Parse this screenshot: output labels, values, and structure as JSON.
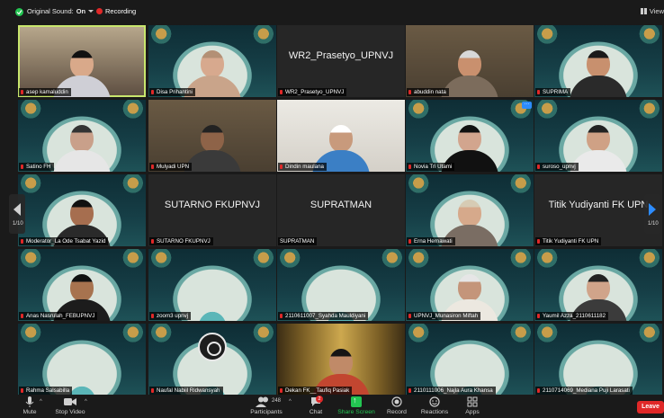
{
  "topbar": {
    "original_sound_label": "Original Sound:",
    "original_sound_value": "On",
    "recording_label": "Recording",
    "view_label": "View"
  },
  "tiles": [
    {
      "name": "asep kamaluddin",
      "bg": "room",
      "active": true,
      "skin": "#d9a98a",
      "shirt": "#cfcfd6",
      "head": "#111"
    },
    {
      "name": "Disa Prihantini",
      "bg": "decor",
      "skin": "#d7a98e",
      "shirt": "#c9a48a",
      "head": "#b39075"
    },
    {
      "name": "WR2_Prasetyo_UPNVJ",
      "bg": "dark",
      "center": "WR2_Prasetyo_UPNVJ"
    },
    {
      "name": "abuddin nata",
      "bg": "wall",
      "skin": "#c9906e",
      "shirt": "#7c6c5c",
      "head": "#d8d8d8"
    },
    {
      "name": "SUPRIMA",
      "bg": "decor",
      "skin": "#c8906e",
      "shirt": "#2a2a2a",
      "head": "#1a1a1a"
    },
    {
      "name": "Satino FH",
      "bg": "decor",
      "skin": "#c9a08a",
      "shirt": "#e6e6e6",
      "head": "#333"
    },
    {
      "name": "Mulyadi UPN",
      "bg": "wall",
      "skin": "#8e6348",
      "shirt": "#3a3a3a",
      "head": "#222"
    },
    {
      "name": "Dindin maulana",
      "bg": "white",
      "skin": "#c89a7c",
      "shirt": "#3b7fc5",
      "head": "#fff"
    },
    {
      "name": "Novia Tri Utami",
      "bg": "decor",
      "skin": "#d2a58e",
      "shirt": "#111",
      "head": "#111",
      "badge": "···"
    },
    {
      "name": "suroso_upnvj",
      "bg": "decor",
      "skin": "#cfa185",
      "shirt": "#eaeaea",
      "head": "#222"
    },
    {
      "name": "Moderator_La Ode Tsabat Yazid",
      "bg": "decor",
      "skin": "#a66e4f",
      "shirt": "#2a2a2a",
      "head": "#111"
    },
    {
      "name": "SUTARNO FKUPNVJ",
      "bg": "dark",
      "center": "SUTARNO FKUPNVJ"
    },
    {
      "name": "SUPRATMAN",
      "bg": "dark",
      "center": "SUPRATMAN",
      "nomic": true
    },
    {
      "name": "Erna Hernawati",
      "bg": "decor",
      "skin": "#d6a98b",
      "shirt": "#7a6d63",
      "head": "#d6cbb4"
    },
    {
      "name": "Titik Yudiyanti FK UPN",
      "bg": "dark",
      "center": "Titik Yudiyanti FK UPN"
    },
    {
      "name": "Anas Nasrulah_FEBUPNVJ",
      "bg": "decor",
      "skin": "#a7734f",
      "shirt": "#1c1c1c",
      "head": "#111"
    },
    {
      "name": "zoom3 upnvj",
      "bg": "decor"
    },
    {
      "name": "2110611007_Syahda Mauldiyani",
      "bg": "decor"
    },
    {
      "name": "UPNVJ_Munasiron Miftah",
      "bg": "decor",
      "skin": "#c4957a",
      "shirt": "#ece8e0",
      "head": "#e6e6e6"
    },
    {
      "name": "Yaumil Azza_2110611182",
      "bg": "decor",
      "skin": "#d0a48a",
      "shirt": "#3b3b3b",
      "head": "#222"
    },
    {
      "name": "Rahma Salsabilla",
      "bg": "decor"
    },
    {
      "name": "Naufal Nabiil Ridwansyah",
      "bg": "decor",
      "obs": true
    },
    {
      "name": "Dekan FK__Taufiq Pasiak",
      "bg": "gold",
      "skin": "#c08a68",
      "shirt": "#c24630",
      "head": "#151515"
    },
    {
      "name": "2110111006_Najla Aura Khansa",
      "bg": "decor"
    },
    {
      "name": "2110714069_Mediana Puji Larasati",
      "bg": "decor"
    }
  ],
  "pager": {
    "left": "1/10",
    "right": "1/10"
  },
  "toolbar": {
    "mute": "Mute",
    "stop_video": "Stop Video",
    "participants": "Participants",
    "participants_count": "248",
    "chat": "Chat",
    "chat_badge": "2",
    "share_screen": "Share Screen",
    "record": "Record",
    "reactions": "Reactions",
    "apps": "Apps",
    "leave": "Leave"
  },
  "colors": {
    "accent": "#2d8cff",
    "active_speaker": "#c8e66d",
    "record": "#e02828",
    "share": "#23c552",
    "leave": "#e02828"
  }
}
